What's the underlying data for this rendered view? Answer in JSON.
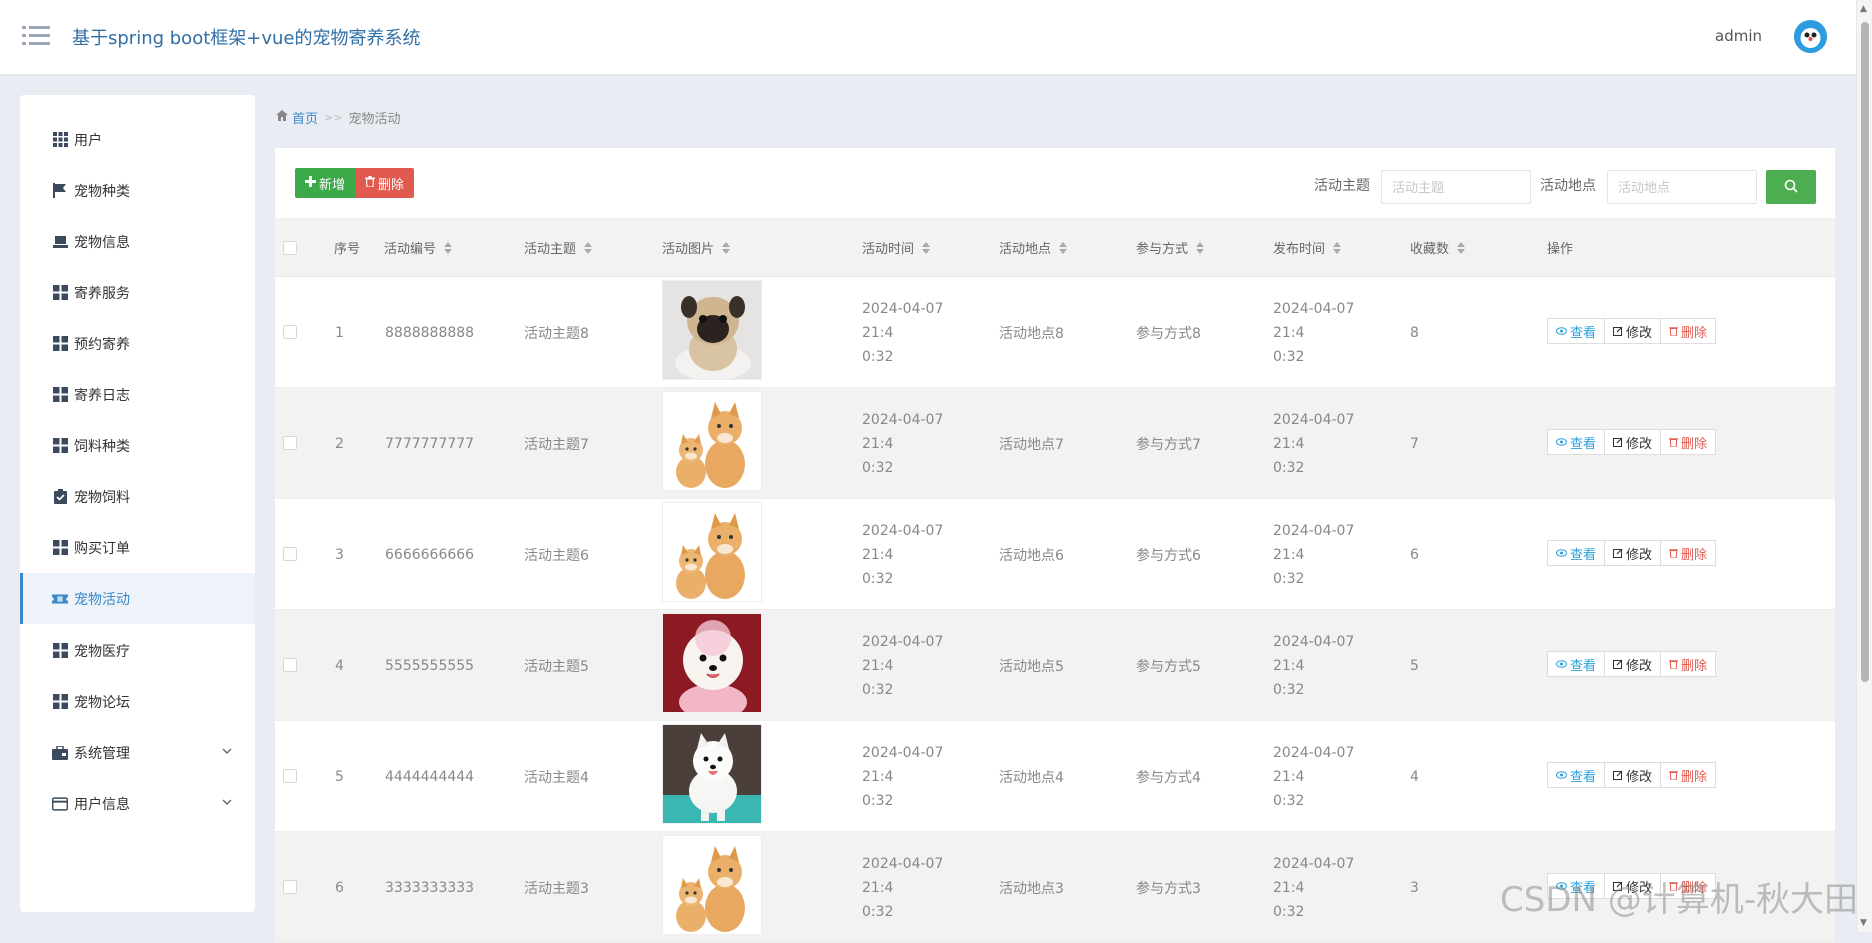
{
  "header": {
    "title": "基于spring boot框架+vue的宠物寄养系统",
    "user": "admin"
  },
  "sidebar": {
    "items": [
      {
        "label": "用户",
        "icon": "grid-icon"
      },
      {
        "label": "宠物种类",
        "icon": "flag-icon"
      },
      {
        "label": "宠物信息",
        "icon": "laptop-icon"
      },
      {
        "label": "寄养服务",
        "icon": "grid-icon"
      },
      {
        "label": "预约寄养",
        "icon": "grid-icon"
      },
      {
        "label": "寄养日志",
        "icon": "grid-icon"
      },
      {
        "label": "饲料种类",
        "icon": "grid-icon"
      },
      {
        "label": "宠物饲料",
        "icon": "clipboard-check-icon"
      },
      {
        "label": "购买订单",
        "icon": "grid-icon"
      },
      {
        "label": "宠物活动",
        "icon": "ticket-icon",
        "active": true
      },
      {
        "label": "宠物医疗",
        "icon": "grid-icon"
      },
      {
        "label": "宠物论坛",
        "icon": "grid-icon"
      },
      {
        "label": "系统管理",
        "icon": "briefcase-icon",
        "expandable": true
      },
      {
        "label": "用户信息",
        "icon": "card-icon",
        "expandable": true
      }
    ]
  },
  "breadcrumb": {
    "home": "首页",
    "separator": ">>",
    "current": "宠物活动"
  },
  "toolbar": {
    "add_label": "新增",
    "delete_label": "删除"
  },
  "search": {
    "theme_label": "活动主题",
    "theme_placeholder": "活动主题",
    "location_label": "活动地点",
    "location_placeholder": "活动地点"
  },
  "table": {
    "headers": {
      "index": "序号",
      "code": "活动编号",
      "theme": "活动主题",
      "image": "活动图片",
      "time": "活动时间",
      "location": "活动地点",
      "method": "参与方式",
      "publish": "发布时间",
      "favorites": "收藏数",
      "actions": "操作"
    },
    "rows": [
      {
        "index": "1",
        "code": "8888888888",
        "theme": "活动主题8",
        "image": "pug",
        "time_line1": "2024-04-07 21:4",
        "time_line2": "0:32",
        "location": "活动地点8",
        "method": "参与方式8",
        "publish_line1": "2024-04-07 21:4",
        "publish_line2": "0:32",
        "favorites": "8"
      },
      {
        "index": "2",
        "code": "7777777777",
        "theme": "活动主题7",
        "image": "cats",
        "time_line1": "2024-04-07 21:4",
        "time_line2": "0:32",
        "location": "活动地点7",
        "method": "参与方式7",
        "publish_line1": "2024-04-07 21:4",
        "publish_line2": "0:32",
        "favorites": "7"
      },
      {
        "index": "3",
        "code": "6666666666",
        "theme": "活动主题6",
        "image": "cats",
        "time_line1": "2024-04-07 21:4",
        "time_line2": "0:32",
        "location": "活动地点6",
        "method": "参与方式6",
        "publish_line1": "2024-04-07 21:4",
        "publish_line2": "0:32",
        "favorites": "6"
      },
      {
        "index": "4",
        "code": "5555555555",
        "theme": "活动主题5",
        "image": "pomeranian",
        "time_line1": "2024-04-07 21:4",
        "time_line2": "0:32",
        "location": "活动地点5",
        "method": "参与方式5",
        "publish_line1": "2024-04-07 21:4",
        "publish_line2": "0:32",
        "favorites": "5"
      },
      {
        "index": "5",
        "code": "4444444444",
        "theme": "活动主题4",
        "image": "samoyed",
        "time_line1": "2024-04-07 21:4",
        "time_line2": "0:32",
        "location": "活动地点4",
        "method": "参与方式4",
        "publish_line1": "2024-04-07 21:4",
        "publish_line2": "0:32",
        "favorites": "4"
      },
      {
        "index": "6",
        "code": "3333333333",
        "theme": "活动主题3",
        "image": "cats",
        "time_line1": "2024-04-07 21:4",
        "time_line2": "0:32",
        "location": "活动地点3",
        "method": "参与方式3",
        "publish_line1": "2024-04-07 21:4",
        "publish_line2": "0:32",
        "favorites": "3"
      }
    ],
    "actions": {
      "view": "查看",
      "edit": "修改",
      "delete": "删除"
    }
  },
  "watermark": "CSDN @计算机-秋大田",
  "colors": {
    "accent": "#3a88c9",
    "success": "#3daa4a",
    "danger": "#e05a4f",
    "info": "#2ea0d8"
  }
}
